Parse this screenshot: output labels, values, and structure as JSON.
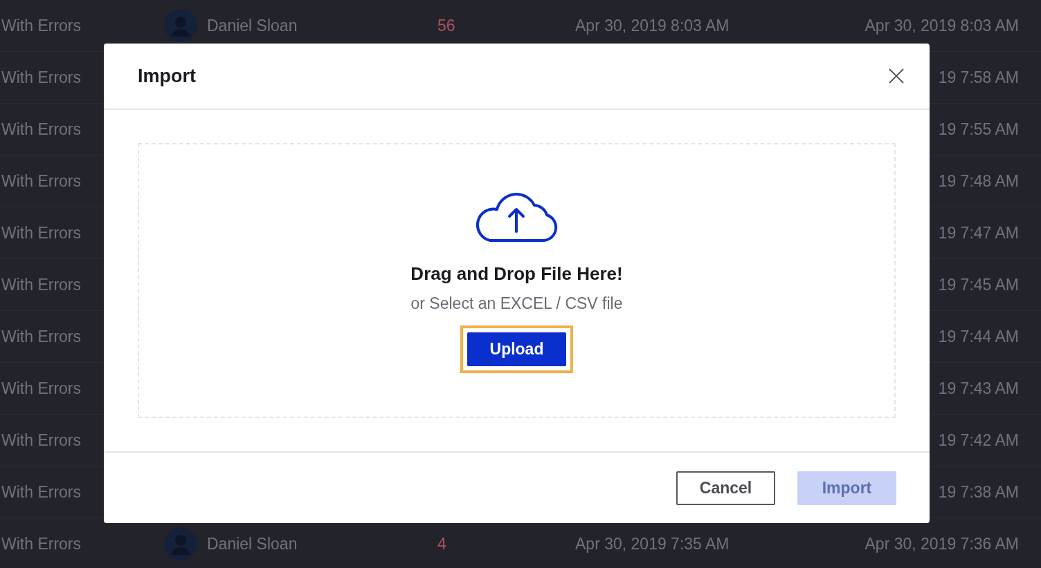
{
  "table": {
    "rows": [
      {
        "status": "With Errors",
        "owner": "Daniel Sloan",
        "count": "56",
        "created": "Apr 30, 2019 8:03 AM",
        "updated": "Apr 30, 2019 8:03 AM"
      },
      {
        "status": "With Errors",
        "updated": "19 7:58 AM"
      },
      {
        "status": "With Errors",
        "updated": "19 7:55 AM"
      },
      {
        "status": "With Errors",
        "updated": "19 7:48 AM"
      },
      {
        "status": "With Errors",
        "updated": "19 7:47 AM"
      },
      {
        "status": "With Errors",
        "updated": "19 7:45 AM"
      },
      {
        "status": "With Errors",
        "updated": "19 7:44 AM"
      },
      {
        "status": "With Errors",
        "updated": "19 7:43 AM"
      },
      {
        "status": "With Errors",
        "updated": "19 7:42 AM"
      },
      {
        "status": "With Errors",
        "updated": "19 7:38 AM"
      },
      {
        "status": "With Errors",
        "owner": "Daniel Sloan",
        "count": "4",
        "created": "Apr 30, 2019 7:35 AM",
        "updated": "Apr 30, 2019 7:36 AM"
      }
    ]
  },
  "dialog": {
    "title": "Import",
    "dropzone": {
      "heading": "Drag and Drop File Here!",
      "subtext": "or Select an EXCEL / CSV file",
      "upload_button": {
        "label": "Upload",
        "focused": true
      }
    },
    "buttons": [
      {
        "label": "Cancel",
        "kind": "secondary",
        "disabled": false
      },
      {
        "label": "Import",
        "kind": "primary",
        "disabled": true
      }
    ]
  }
}
